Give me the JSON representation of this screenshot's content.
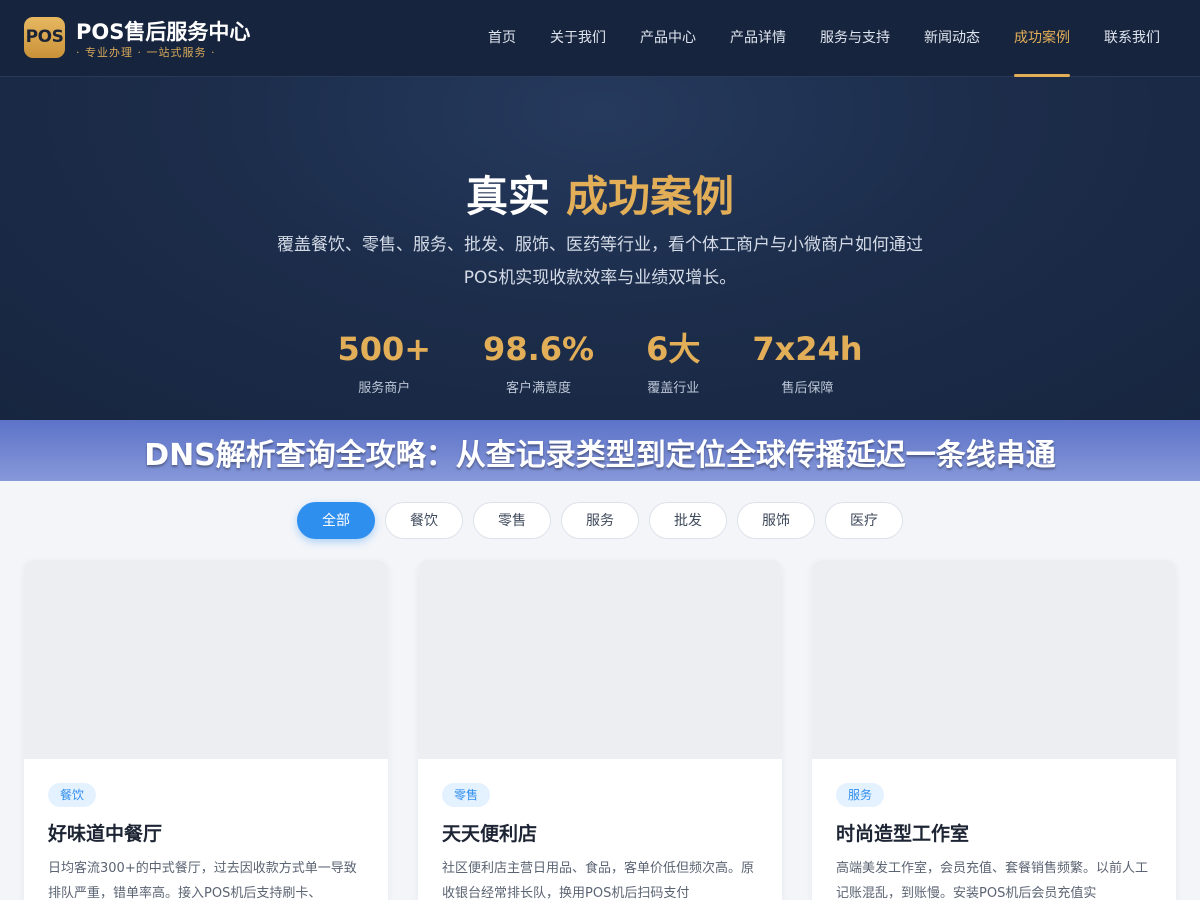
{
  "header": {
    "logo_text": "POS",
    "title": "POS售后服务中心",
    "subtitle": "· 专业办理 · 一站式服务 ·",
    "nav": [
      {
        "label": "首页"
      },
      {
        "label": "关于我们"
      },
      {
        "label": "产品中心"
      },
      {
        "label": "产品详情"
      },
      {
        "label": "服务与支持"
      },
      {
        "label": "新闻动态"
      },
      {
        "label": "成功案例"
      },
      {
        "label": "联系我们"
      }
    ],
    "active_nav": "成功案例"
  },
  "hero": {
    "title_plain": "真实",
    "title_accent": "成功案例",
    "description": "覆盖餐饮、零售、服务、批发、服饰、医药等行业，看个体工商户与小微商户如何通过POS机实现收款效率与业绩双增长。",
    "stats": [
      {
        "value": "500+",
        "label": "服务商户"
      },
      {
        "value": "98.6%",
        "label": "客户满意度"
      },
      {
        "value": "6大",
        "label": "覆盖行业"
      },
      {
        "value": "7x24h",
        "label": "售后保障"
      }
    ]
  },
  "banner": {
    "text": "DNS解析查询全攻略：从查记录类型到定位全球传播延迟一条线串通"
  },
  "filters": {
    "options": [
      {
        "label": "全部"
      },
      {
        "label": "餐饮"
      },
      {
        "label": "零售"
      },
      {
        "label": "服务"
      },
      {
        "label": "批发"
      },
      {
        "label": "服饰"
      },
      {
        "label": "医疗"
      }
    ],
    "selected": "全部"
  },
  "cases": [
    {
      "tag": "餐饮",
      "title": "好味道中餐厅",
      "description": "日均客流300+的中式餐厅，过去因收款方式单一导致排队严重，错单率高。接入POS机后支持刷卡、"
    },
    {
      "tag": "零售",
      "title": "天天便利店",
      "description": "社区便利店主营日用品、食品，客单价低但频次高。原收银台经常排长队，换用POS机后扫码支付"
    },
    {
      "tag": "服务",
      "title": "时尚造型工作室",
      "description": "高端美发工作室，会员充值、套餐销售频繁。以前人工记账混乱，到账慢。安装POS机后会员充值实"
    }
  ],
  "colors": {
    "header_bg": "#17243d",
    "accent_gold": "#e2ae58",
    "primary_blue": "#2f8fee",
    "banner_bg": "#6f84d0"
  }
}
